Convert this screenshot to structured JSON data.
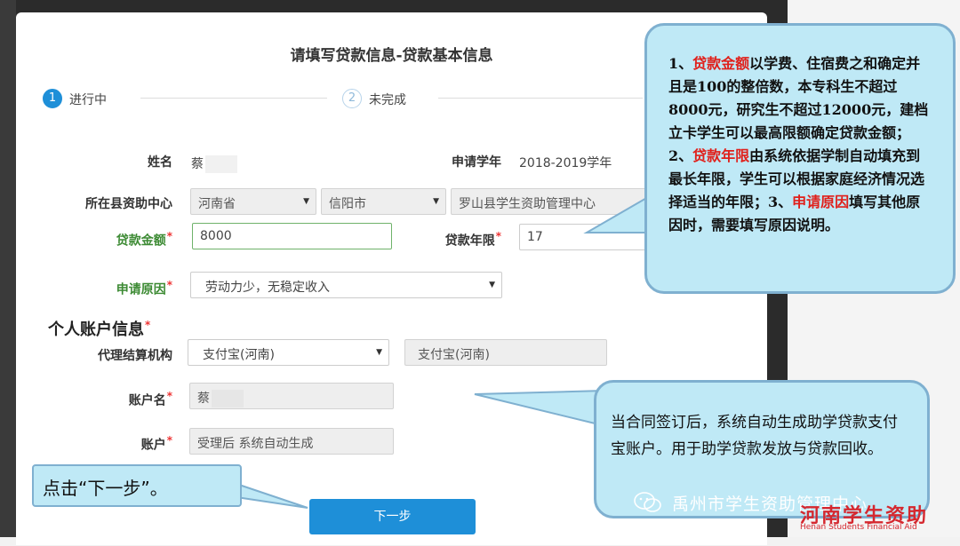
{
  "dialog": {
    "title": "请填写贷款信息-贷款基本信息",
    "steps": [
      {
        "number": "1",
        "label": "进行中"
      },
      {
        "number": "2",
        "label": "未完成"
      }
    ]
  },
  "form": {
    "name_label": "姓名",
    "name_value": "蔡",
    "year_label": "申请学年",
    "year_value": "2018-2019学年",
    "center_label": "所在县资助中心",
    "province": "河南省",
    "city": "信阳市",
    "county": "罗山县学生资助管理中心",
    "amount_label": "贷款金额",
    "amount_value": "8000",
    "term_label": "贷款年限",
    "term_value": "17",
    "reason_label": "申请原因",
    "reason_value": "劳动力少，无稳定收入",
    "account_section_title": "个人账户信息",
    "agent_label": "代理结算机构",
    "agent_select": "支付宝(河南)",
    "agent_display": "支付宝(河南)",
    "account_name_label": "账户名",
    "account_name_value": "蔡",
    "account_label": "账户",
    "account_value": "受理后 系统自动生成",
    "next_button": "下一步",
    "required_mark": "*"
  },
  "callouts": {
    "top_p1": "1、",
    "top_r1": "贷款金额",
    "top_p2": "以学费、住宿费之和确定并且是100的整倍数，本专科生不超过8000元，研究生不超过12000元，建档立卡学生可以最高限额确定贷款金额；2、",
    "top_r2": "贷款年限",
    "top_p3": "由系统依据学制自动填充到最长年限，学生可以根据家庭经济情况选择适当的年限；3、",
    "top_r3": "申请原因",
    "top_p4": "填写其他原因时，需要填写原因说明。",
    "middle": "当合同签订后，系统自动生成助学贷款支付宝账户。用于助学贷款发放与贷款回收。",
    "bottom": "点击“下一步”。"
  },
  "watermark": {
    "text": "禹州市学生资助管理中心",
    "logo_cn": "河南学生资助",
    "logo_en": "Henan Students Financial Aid"
  },
  "colors": {
    "primary": "#1e8fd8",
    "highlight_red": "#e0201b",
    "bubble_bg": "#bfe9f6"
  }
}
